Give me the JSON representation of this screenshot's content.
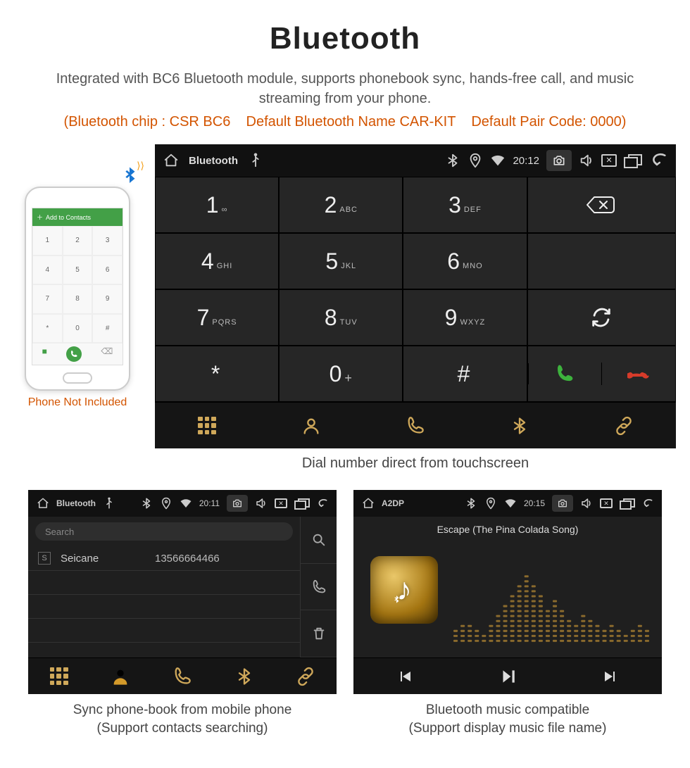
{
  "header": {
    "title": "Bluetooth",
    "subtitle": "Integrated with BC6 Bluetooth module, supports phonebook sync, hands-free call, and music streaming from your phone.",
    "specs": "(Bluetooth chip : CSR BC6    Default Bluetooth Name CAR-KIT    Default Pair Code: 0000)"
  },
  "phone": {
    "add_contacts": "Add to Contacts",
    "keys": [
      "1",
      "2",
      "3",
      "4",
      "5",
      "6",
      "7",
      "8",
      "9",
      "*",
      "0",
      "#"
    ],
    "caption": "Phone Not Included"
  },
  "dial": {
    "statusbar": {
      "title": "Bluetooth",
      "time": "20:12"
    },
    "keys": [
      {
        "n": "1",
        "s": "∞"
      },
      {
        "n": "2",
        "s": "ABC"
      },
      {
        "n": "3",
        "s": "DEF"
      },
      {
        "n": "4",
        "s": "GHI"
      },
      {
        "n": "5",
        "s": "JKL"
      },
      {
        "n": "6",
        "s": "MNO"
      },
      {
        "n": "7",
        "s": "PQRS"
      },
      {
        "n": "8",
        "s": "TUV"
      },
      {
        "n": "9",
        "s": "WXYZ"
      },
      {
        "n": "*",
        "s": ""
      },
      {
        "n": "0",
        "s": "+"
      },
      {
        "n": "#",
        "s": ""
      }
    ],
    "caption": "Dial number direct from touchscreen"
  },
  "phonebook": {
    "statusbar": {
      "title": "Bluetooth",
      "time": "20:11"
    },
    "search_placeholder": "Search",
    "contact": {
      "tag": "S",
      "name": "Seicane",
      "number": "13566664466"
    },
    "caption_line1": "Sync phone-book from mobile phone",
    "caption_line2": "(Support contacts searching)"
  },
  "a2dp": {
    "statusbar": {
      "title": "A2DP",
      "time": "20:15"
    },
    "song": "Escape (The Pina Colada Song)",
    "caption_line1": "Bluetooth music compatible",
    "caption_line2": "(Support display music file name)"
  }
}
